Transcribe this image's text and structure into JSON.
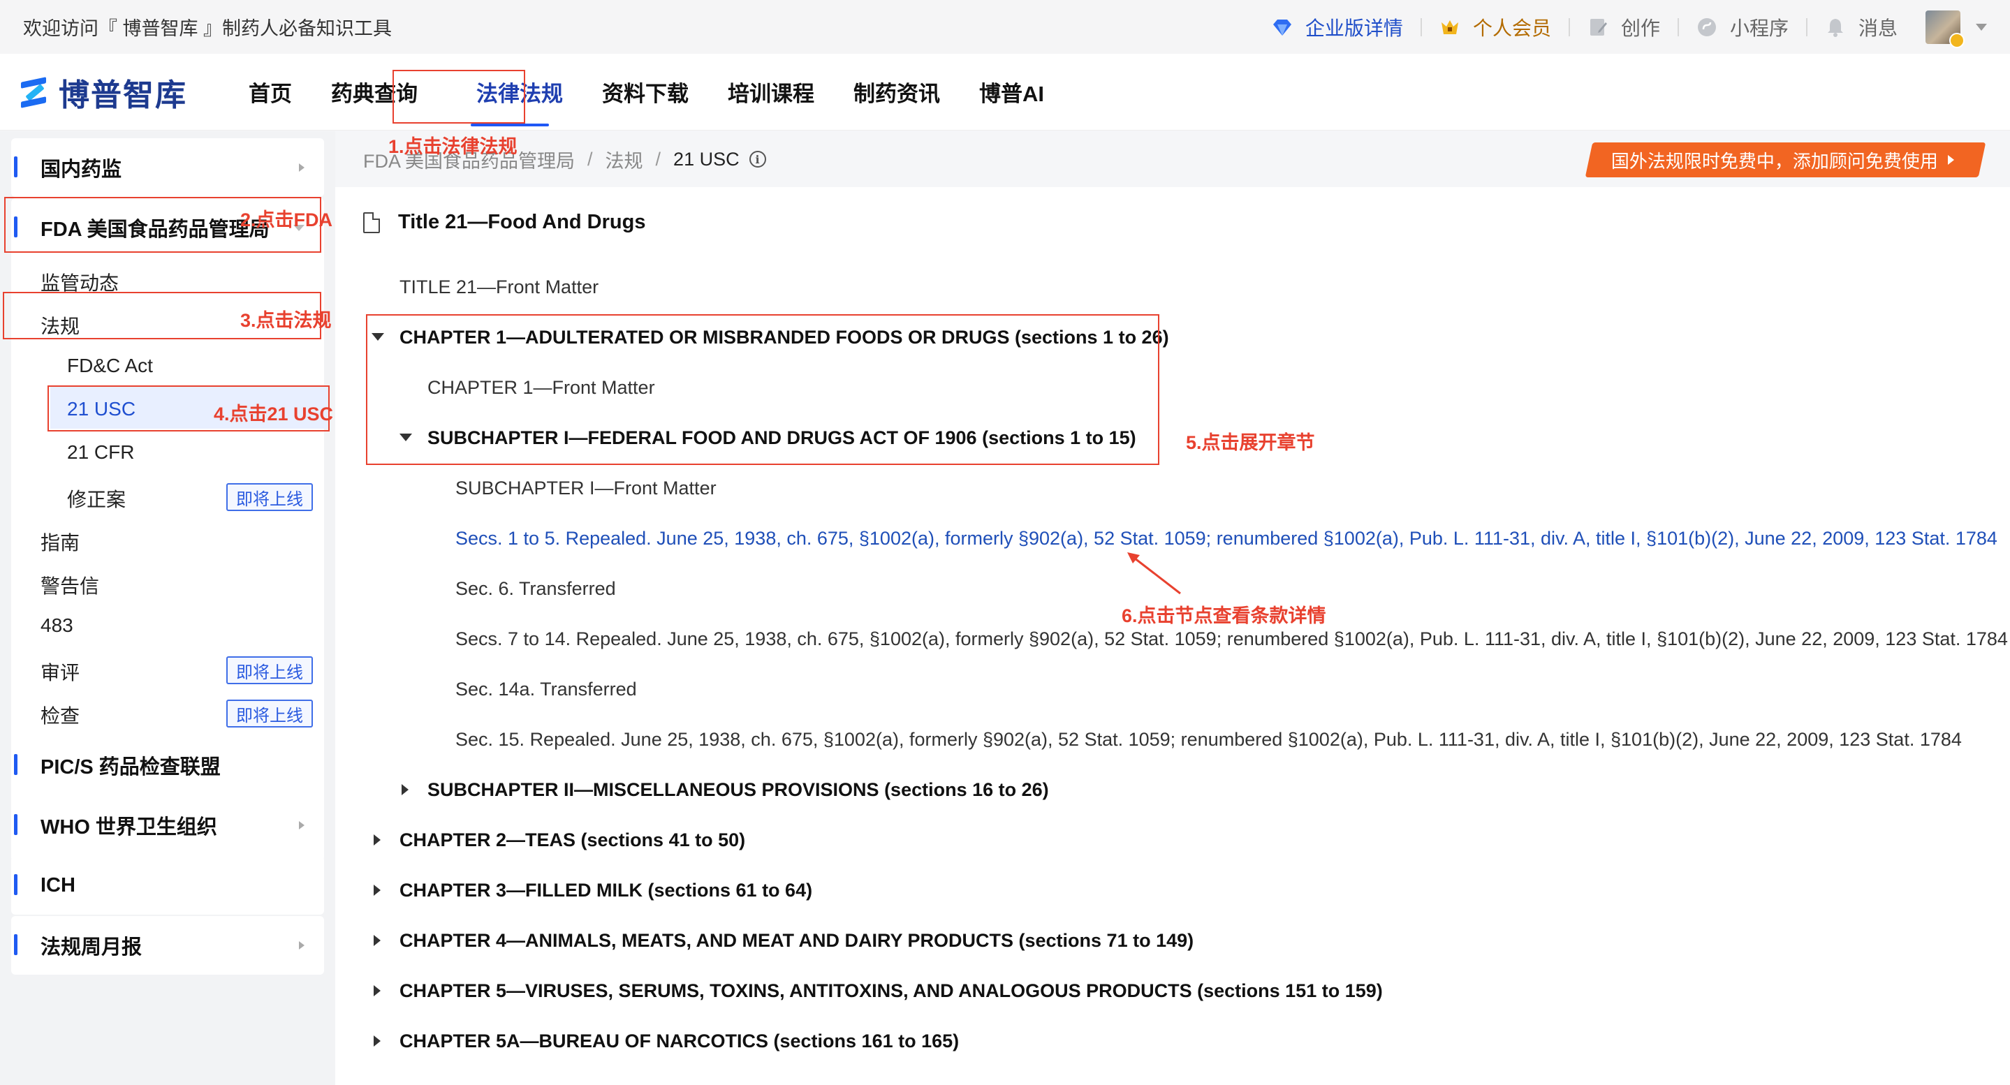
{
  "topbar": {
    "welcome": "欢迎访问『 博普智库 』制药人必备知识工具",
    "enterprise": "企业版详情",
    "vip": "个人会员",
    "create": "创作",
    "miniprogram": "小程序",
    "messages": "消息"
  },
  "nav": {
    "logo": "博普智库",
    "items": [
      "首页",
      "药典查询",
      "法律法规",
      "资料下载",
      "培训课程",
      "制药资讯",
      "博普AI"
    ],
    "active": "法律法规"
  },
  "sidebar": {
    "domestic": "国内药监",
    "fda": "FDA 美国食品药品管理局",
    "fda_sub": {
      "dynamics": "监管动态",
      "regulations": "法规",
      "fdc_act": "FD&C Act",
      "usc": "21 USC",
      "cfr": "21 CFR",
      "amendment": "修正案",
      "guidance": "指南",
      "warning": "警告信",
      "f483": "483",
      "review": "审评",
      "inspection": "检查"
    },
    "coming_soon": "即将上线",
    "pics": "PIC/S 药品检查联盟",
    "who": "WHO 世界卫生组织",
    "ich": "ICH",
    "monthly": "法规周月报"
  },
  "breadcrumb": {
    "items": [
      "FDA 美国食品药品管理局",
      "法规",
      "21 USC"
    ],
    "separator": "/"
  },
  "promo": "国外法规限时免费中，添加顾问免费使用",
  "doc": {
    "title": "Title 21—Food And Drugs",
    "front_matter": "TITLE 21—Front Matter",
    "ch1": "CHAPTER 1—ADULTERATED OR MISBRANDED FOODS OR DRUGS (sections 1 to 26)",
    "ch1_front": "CHAPTER 1—Front Matter",
    "sub1": "SUBCHAPTER I—FEDERAL FOOD AND DRUGS ACT OF 1906 (sections 1 to 15)",
    "sub1_front": "SUBCHAPTER I—Front Matter",
    "secs1_5": "Secs. 1 to 5. Repealed. June 25, 1938, ch. 675, §1002(a), formerly §902(a), 52 Stat. 1059; renumbered §1002(a), Pub. L. 111-31, div. A, title I, §101(b)(2), June 22, 2009, 123 Stat. 1784",
    "sec6": "Sec. 6. Transferred",
    "secs7_14": "Secs. 7 to 14. Repealed. June 25, 1938, ch. 675, §1002(a), formerly §902(a), 52 Stat. 1059; renumbered §1002(a), Pub. L. 111-31, div. A, title I, §101(b)(2), June 22, 2009, 123 Stat. 1784",
    "sec14a": "Sec. 14a. Transferred",
    "sec15": "Sec. 15. Repealed. June 25, 1938, ch. 675, §1002(a), formerly §902(a), 52 Stat. 1059; renumbered §1002(a), Pub. L. 111-31, div. A, title I, §101(b)(2), June 22, 2009, 123 Stat. 1784",
    "sub2": "SUBCHAPTER II—MISCELLANEOUS PROVISIONS (sections 16 to 26)",
    "ch2": "CHAPTER 2—TEAS (sections 41 to 50)",
    "ch3": "CHAPTER 3—FILLED MILK (sections 61 to 64)",
    "ch4": "CHAPTER 4—ANIMALS, MEATS, AND MEAT AND DAIRY PRODUCTS (sections 71 to 149)",
    "ch5": "CHAPTER 5—VIRUSES, SERUMS, TOXINS, ANTITOXINS, AND ANALOGOUS PRODUCTS (sections 151 to 159)",
    "ch5a": "CHAPTER 5A—BUREAU OF NARCOTICS (sections 161 to 165)"
  },
  "annotations": {
    "step1": "1.点击法律法规",
    "step2": "2.点击FDA",
    "step3": "3.点击法规",
    "step4": "4.点击21 USC",
    "step5": "5.点击展开章节",
    "step6": "6.点击节点查看条款详情"
  },
  "colors": {
    "brand": "#1f57f5",
    "annotation": "#e8412f",
    "promo": "#f26522",
    "link": "#1f4fb8"
  }
}
